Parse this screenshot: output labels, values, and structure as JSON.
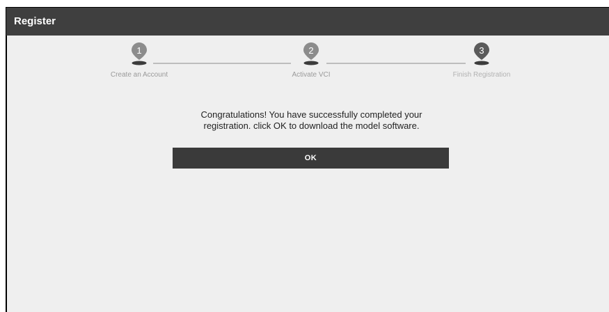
{
  "header": {
    "title": "Register"
  },
  "steps": [
    {
      "number": "1",
      "label": "Create an Account"
    },
    {
      "number": "2",
      "label": "Activate VCI"
    },
    {
      "number": "3",
      "label": "Finish Registration"
    }
  ],
  "message": "Congratulations! You have successfully completed your\nregistration. click OK to download the model software.",
  "ok_label": "OK",
  "colors": {
    "header": "#3f3f3f",
    "content_bg": "#efefef",
    "marker": "#8c8c8c",
    "marker_active": "#5a5a5a",
    "button": "#3a3a3a"
  }
}
